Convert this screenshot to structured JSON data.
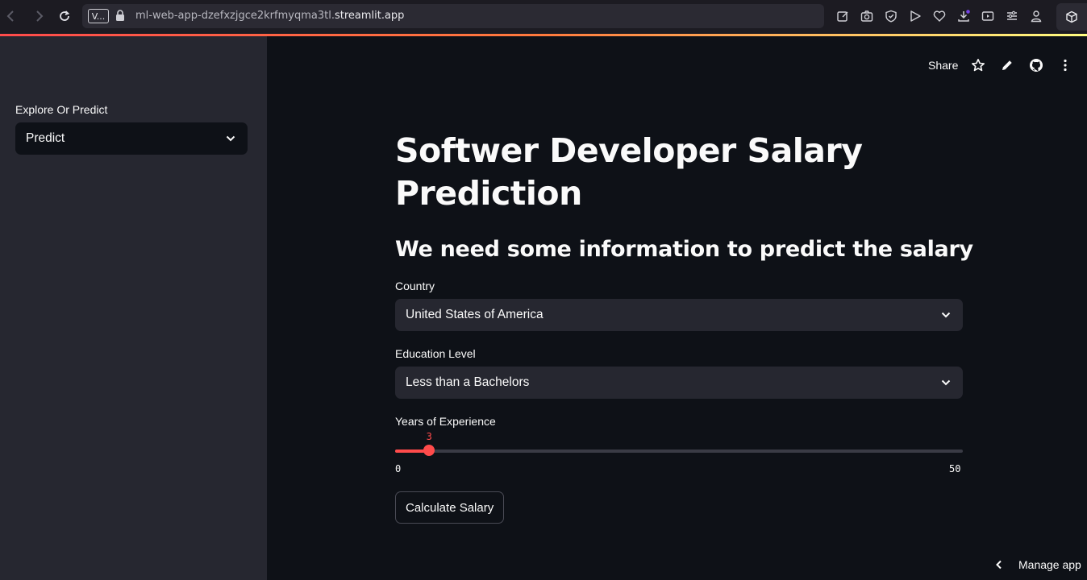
{
  "browser": {
    "tab_badge": "V...",
    "url_prefix": "ml-web-app-dzefxzjgce2krfmyqma3tl.",
    "url_host": "streamlit.app"
  },
  "sidebar": {
    "label": "Explore Or Predict",
    "select_value": "Predict"
  },
  "header": {
    "share_label": "Share"
  },
  "main": {
    "title": "Softwer Developer Salary Prediction",
    "subtitle": "We need some information to predict the salary",
    "country_label": "Country",
    "country_value": "United States of America",
    "education_label": "Education Level",
    "education_value": "Less than a Bachelors",
    "experience_label": "Years of Experience",
    "experience_value": "3",
    "experience_min": "0",
    "experience_max": "50",
    "calculate_button": "Calculate Salary"
  },
  "footer": {
    "manage_app": "Manage app"
  },
  "colors": {
    "accent": "#ff4b4b",
    "background": "#0e1117",
    "sidebar": "#262730"
  }
}
